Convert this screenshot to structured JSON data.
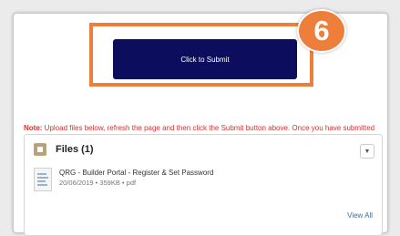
{
  "submit": {
    "label": "Click to Submit"
  },
  "step_badge": {
    "number": "6"
  },
  "note": {
    "prefix": "Note:",
    "text": " Upload files below, refresh the page and then click the Submit button above. Once you have submitted the case, you will no longer be allowed to upload any new files."
  },
  "files": {
    "title": "Files (1)",
    "items": [
      {
        "name": "QRG - Builder Portal - Register & Set Password",
        "meta": "20/06/2019 • 359KB • pdf"
      }
    ],
    "view_all": "View All"
  },
  "icons": {
    "folder": "file-folder-icon",
    "dropdown": "chevron-down-icon",
    "document": "document-icon"
  },
  "colors": {
    "button": "#0d0d5e",
    "highlight": "#ee7f3b",
    "note": "#d93131",
    "link": "#3a6ea8"
  }
}
